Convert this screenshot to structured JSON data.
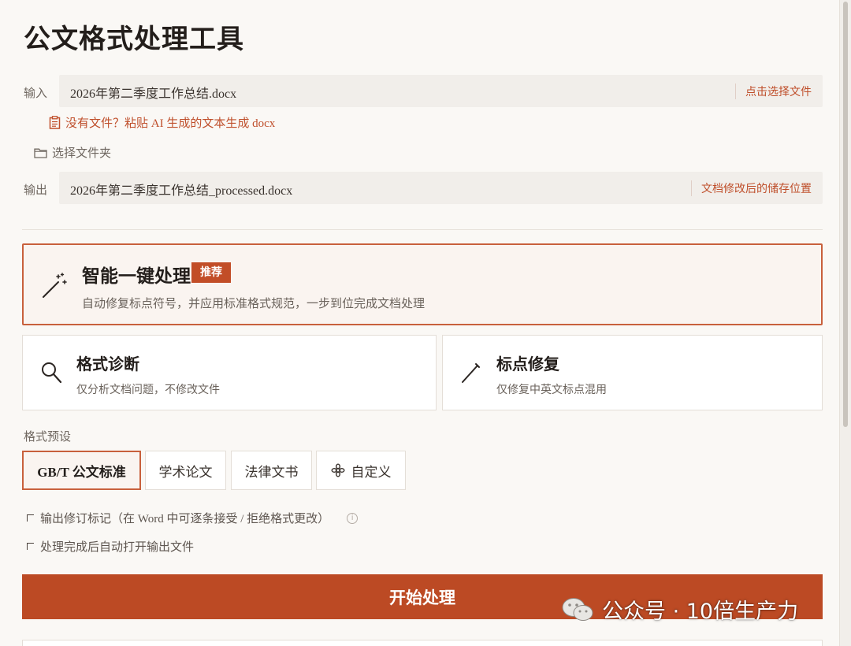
{
  "app": {
    "title": "公文格式处理工具"
  },
  "input": {
    "label": "输入",
    "value": "2026年第二季度工作总结.docx",
    "action": "点击选择文件",
    "paste_link": "没有文件？粘贴 AI 生成的文本生成 docx",
    "folder_link": "选择文件夹"
  },
  "output": {
    "label": "输出",
    "value": "2026年第二季度工作总结_processed.docx",
    "action": "文档修改后的储存位置"
  },
  "modes": {
    "smart": {
      "name": "智能一键处理",
      "badge": "推荐",
      "desc": "自动修复标点符号，并应用标准格式规范，一步到位完成文档处理",
      "icon": "magic-wand-icon"
    },
    "diagnose": {
      "name": "格式诊断",
      "desc": "仅分析文档问题，不修改文件",
      "icon": "search-icon"
    },
    "punct": {
      "name": "标点修复",
      "desc": "仅修复中英文标点混用",
      "icon": "pen-icon"
    }
  },
  "presets": {
    "label": "格式预设",
    "items": [
      {
        "label": "GB/T 公文标准",
        "selected": true
      },
      {
        "label": "学术论文",
        "selected": false
      },
      {
        "label": "法律文书",
        "selected": false
      },
      {
        "label": "自定义",
        "selected": false,
        "icon": "gear-icon"
      }
    ]
  },
  "options": {
    "track_changes": "输出修订标记（在 Word 中可逐条接受 / 拒绝格式更改）",
    "auto_open": "处理完成后自动打开输出文件"
  },
  "start_button": "开始处理",
  "watermark": "公众号 · 10倍生产力",
  "colors": {
    "accent": "#bc4a24",
    "accent_border": "#c8603c",
    "background": "#faf8f5",
    "field_bg": "#f1eeea"
  }
}
